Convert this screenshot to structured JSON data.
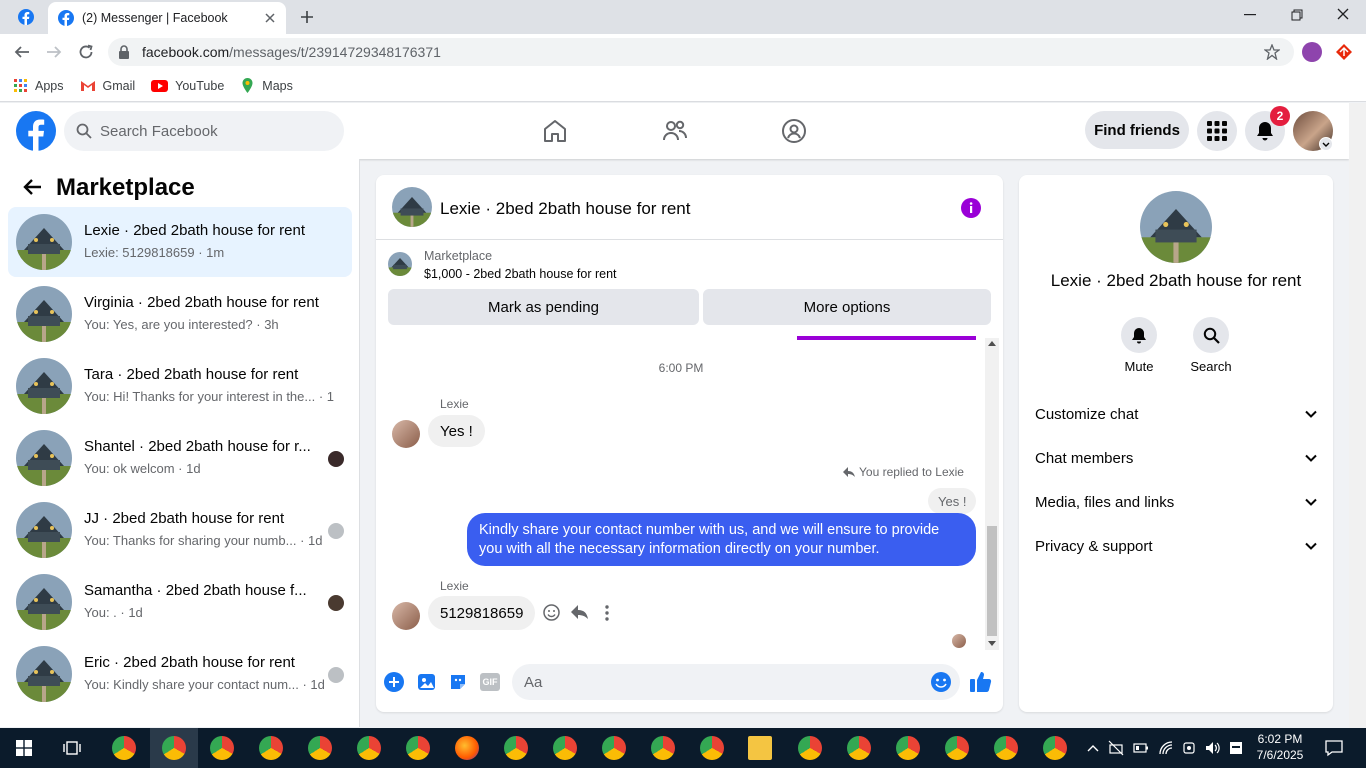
{
  "browser": {
    "tab_title": "(2) Messenger | Facebook",
    "url_domain": "facebook.com",
    "url_path": "/messages/t/23914729348176371",
    "bookmarks": [
      {
        "label": "Apps",
        "icon": "apps-grid-icon"
      },
      {
        "label": "Gmail",
        "icon": "gmail-icon"
      },
      {
        "label": "YouTube",
        "icon": "youtube-icon"
      },
      {
        "label": "Maps",
        "icon": "maps-icon"
      }
    ]
  },
  "header": {
    "search_placeholder": "Search Facebook",
    "find_friends": "Find friends",
    "notification_count": "2"
  },
  "sidebar": {
    "title": "Marketplace",
    "conversations": [
      {
        "name": "Lexie · 2bed 2bath house for rent",
        "preview": "Lexie: 5129818659 · 1m"
      },
      {
        "name": "Virginia · 2bed 2bath house for rent",
        "preview": "You: Yes, are you interested? · 3h"
      },
      {
        "name": "Tara · 2bed 2bath house for rent",
        "preview": "You: Hi! Thanks for your interest in the... · 1d"
      },
      {
        "name": "Shantel · 2bed 2bath house for r...",
        "preview": "You: ok welcom · 1d"
      },
      {
        "name": "JJ · 2bed 2bath house for rent",
        "preview": "You: Thanks for sharing your numb... · 1d"
      },
      {
        "name": "Samantha · 2bed 2bath house f...",
        "preview": "You: . · 1d"
      },
      {
        "name": "Eric · 2bed 2bath house for rent",
        "preview": "You: Kindly share your contact num... · 1d"
      }
    ]
  },
  "chat": {
    "title": "Lexie · 2bed 2bath house for rent",
    "listing_label": "Marketplace",
    "listing_price": "$1,000 - 2bed 2bath house for rent",
    "mark_pending": "Mark as pending",
    "more_options": "More options",
    "timestamp": "6:00 PM",
    "sender": "Lexie",
    "msg1": "Yes !",
    "replied_label": "You replied to Lexie",
    "quoted": "Yes !",
    "outgoing": "Kindly share your contact number with us, and we will ensure to provide you with all the necessary information directly on your number.",
    "sender2": "Lexie",
    "msg2": "5129818659",
    "composer_placeholder": "Aa"
  },
  "details": {
    "name": "Lexie · 2bed 2bath house for rent",
    "mute": "Mute",
    "search": "Search",
    "sections": [
      "Customize chat",
      "Chat members",
      "Media, files and links",
      "Privacy & support"
    ]
  },
  "taskbar": {
    "time": "6:02 PM",
    "date": "7/6/2025"
  },
  "colors": {
    "fb_blue": "#1877f2",
    "messenger_bubble": "#3a5ef0",
    "accent_purple": "#9a00d7"
  }
}
